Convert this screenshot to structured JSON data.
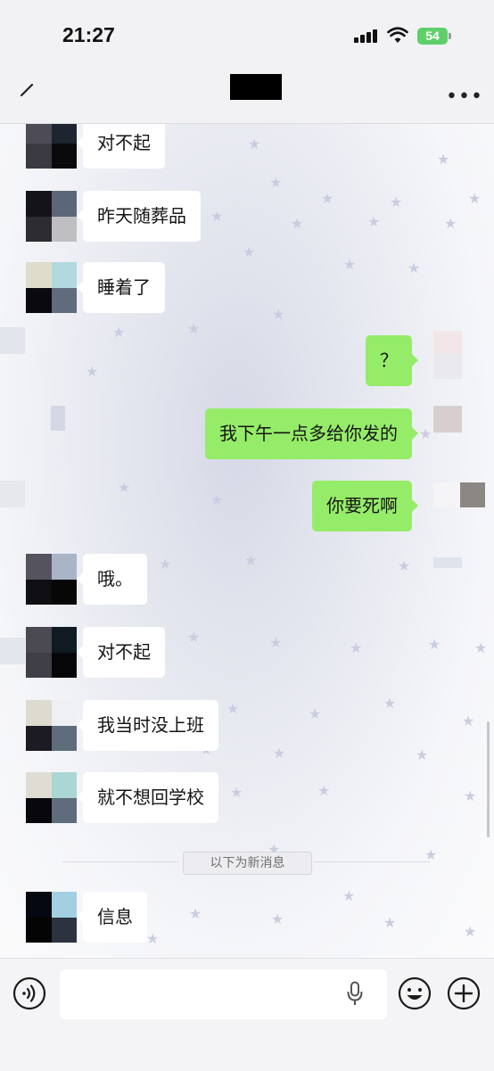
{
  "status_bar": {
    "time": "21:27",
    "battery": "54"
  },
  "nav": {
    "title": ""
  },
  "messages": [
    {
      "side": "in",
      "text": "对不起",
      "avatar": [
        "#4d4b55",
        "#1d2530",
        "#3b3a42",
        "#0a0a0c"
      ]
    },
    {
      "side": "in",
      "text": "昨天随葬品",
      "avatar": [
        "#141418",
        "#5b6779",
        "#2c2c31",
        "#bfbfc2"
      ]
    },
    {
      "side": "in",
      "text": "睡着了",
      "avatar": [
        "#dedccb",
        "#b2d8e0",
        "#0a0910",
        "#5f6c7c"
      ]
    },
    {
      "side": "out",
      "text": "？"
    },
    {
      "side": "out",
      "text": "我下午一点多给你发的"
    },
    {
      "side": "out",
      "text": "你要死啊"
    },
    {
      "side": "in",
      "text": "哦。",
      "avatar": [
        "#55535e",
        "#a9b4c7",
        "#0e0e13",
        "#070707"
      ]
    },
    {
      "side": "in",
      "text": "对不起",
      "avatar": [
        "#4b4951",
        "#0f1a22",
        "#403e47",
        "#060608"
      ]
    },
    {
      "side": "in",
      "text": "我当时没上班",
      "avatar": [
        "#dddbd0",
        "#eef0f4",
        "#1c1a22",
        "#5e6d7c"
      ]
    },
    {
      "side": "in",
      "text": "就不想回学校",
      "avatar": [
        "#dfddd3",
        "#aad6d4",
        "#07070c",
        "#5e6c7c"
      ]
    },
    {
      "side": "in",
      "text": "信息",
      "avatar": [
        "#050810",
        "#a3cfe3",
        "#040404",
        "#2c3340"
      ]
    }
  ],
  "new_message_divider": "以下为新消息",
  "input": {
    "value": "",
    "placeholder": ""
  },
  "icons": {
    "back": "back-arrow-icon",
    "more": "more-icon",
    "voice": "voice-icon",
    "mic": "microphone-icon",
    "emoji": "emoji-icon",
    "plus": "plus-icon"
  },
  "colors": {
    "outgoing_bubble": "#95ec69",
    "incoming_bubble": "#ffffff",
    "battery": "#5fcf6a"
  }
}
